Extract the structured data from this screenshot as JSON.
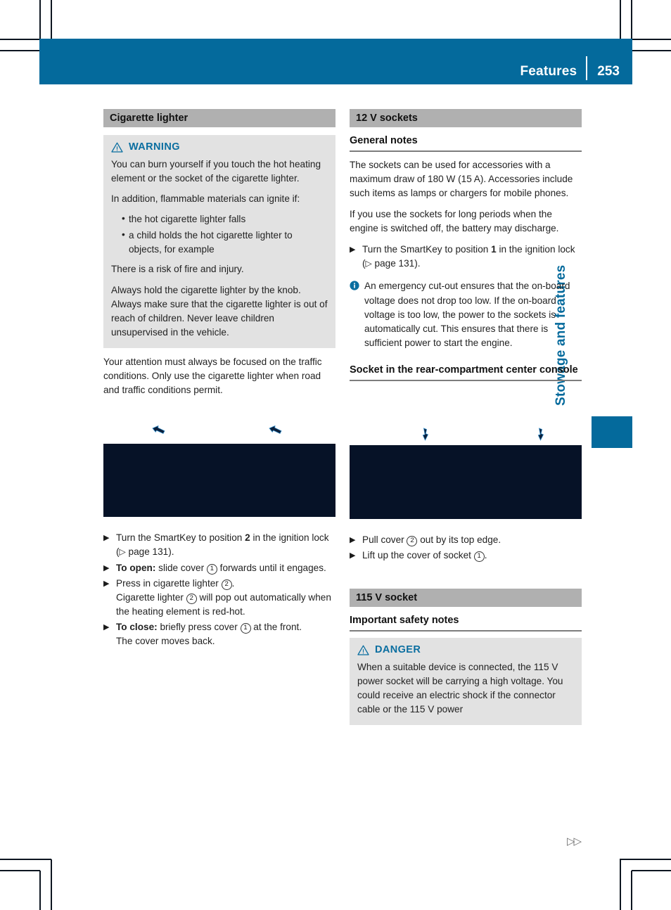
{
  "header": {
    "title": "Features",
    "page_number": "253"
  },
  "side_tab": {
    "label": "Stowage and features"
  },
  "continuation_marker": "▷▷",
  "left_column": {
    "section_title": "Cigarette lighter",
    "warning": {
      "icon": "warning-triangle-icon",
      "label": "WARNING",
      "paragraphs": [
        "You can burn yourself if you touch the hot heating element or the socket of the cigarette lighter.",
        "In addition, flammable materials can ignite if:"
      ],
      "bullets": [
        "the hot cigarette lighter falls",
        "a child holds the hot cigarette lighter to objects, for example"
      ],
      "paragraphs_after": [
        "There is a risk of fire and injury.",
        "Always hold the cigarette lighter by the knob. Always make sure that the cigarette lighter is out of reach of children. Never leave children unsupervised in the vehicle."
      ]
    },
    "note": "Your attention must always be focused on the traffic conditions. Only use the cigarette lighter when road and traffic conditions permit.",
    "figure": {
      "name": "cigarette-lighter-illustration",
      "callout_count": 2
    },
    "steps": [
      {
        "marker": "▶",
        "parts": [
          {
            "t": "text",
            "v": "Turn the SmartKey to position "
          },
          {
            "t": "bold",
            "v": "2"
          },
          {
            "t": "text",
            "v": " in the ignition lock ("
          },
          {
            "t": "refarrow",
            "v": "▷"
          },
          {
            "t": "text",
            "v": " page 131)."
          }
        ]
      },
      {
        "marker": "▶",
        "parts": [
          {
            "t": "bold",
            "v": "To open:"
          },
          {
            "t": "text",
            "v": " slide cover "
          },
          {
            "t": "circle",
            "v": "1"
          },
          {
            "t": "text",
            "v": " forwards until it engages."
          }
        ]
      },
      {
        "marker": "▶",
        "parts": [
          {
            "t": "text",
            "v": "Press in cigarette lighter "
          },
          {
            "t": "circle",
            "v": "2"
          },
          {
            "t": "text",
            "v": "."
          },
          {
            "t": "break",
            "v": ""
          },
          {
            "t": "text",
            "v": "Cigarette lighter "
          },
          {
            "t": "circle",
            "v": "2"
          },
          {
            "t": "text",
            "v": " will pop out automatically when the heating element is red-hot."
          }
        ]
      },
      {
        "marker": "▶",
        "parts": [
          {
            "t": "bold",
            "v": "To close:"
          },
          {
            "t": "text",
            "v": " briefly press cover "
          },
          {
            "t": "circle",
            "v": "1"
          },
          {
            "t": "text",
            "v": " at the front."
          },
          {
            "t": "break",
            "v": ""
          },
          {
            "t": "text",
            "v": "The cover moves back."
          }
        ]
      }
    ]
  },
  "right_column": {
    "section_title": "12 V sockets",
    "general_notes_heading": "General notes",
    "general_notes": [
      "The sockets can be used for accessories with a maximum draw of 180 W (15 A). Accessories include such items as lamps or chargers for mobile phones.",
      "If you use the sockets for long periods when the engine is switched off, the battery may discharge."
    ],
    "general_notes_steps": [
      {
        "marker": "▶",
        "parts": [
          {
            "t": "text",
            "v": "Turn the SmartKey to position "
          },
          {
            "t": "bold",
            "v": "1"
          },
          {
            "t": "text",
            "v": " in the ignition lock ("
          },
          {
            "t": "refarrow",
            "v": "▷"
          },
          {
            "t": "text",
            "v": " page 131)."
          }
        ]
      }
    ],
    "info": {
      "icon": "info-circle-icon",
      "text": "An emergency cut-out ensures that the on-board voltage does not drop too low. If the on-board voltage is too low, the power to the sockets is automatically cut. This ensures that there is sufficient power to start the engine."
    },
    "socket_heading": "Socket in the rear-compartment center console",
    "figure": {
      "name": "rear-console-socket-illustration",
      "callout_count": 2
    },
    "socket_steps": [
      {
        "marker": "▶",
        "parts": [
          {
            "t": "text",
            "v": "Pull cover "
          },
          {
            "t": "circle",
            "v": "2"
          },
          {
            "t": "text",
            "v": " out by its top edge."
          }
        ]
      },
      {
        "marker": "▶",
        "parts": [
          {
            "t": "text",
            "v": "Lift up the cover of socket "
          },
          {
            "t": "circle",
            "v": "1"
          },
          {
            "t": "text",
            "v": "."
          }
        ]
      }
    ],
    "section_title_2": "115 V socket",
    "safety_heading": "Important safety notes",
    "danger": {
      "icon": "warning-triangle-icon",
      "label": "DANGER",
      "text": "When a suitable device is connected, the 115 V power socket will be carrying a high voltage. You could receive an electric shock if the connector cable or the 115 V power"
    }
  },
  "colors": {
    "brand_blue": "#046a9c",
    "notice_label_blue": "#0a6ea0",
    "section_bar_gray": "#b0b0b0",
    "notice_bg_gray": "#e2e2e2",
    "figure_dark": "#061227"
  }
}
